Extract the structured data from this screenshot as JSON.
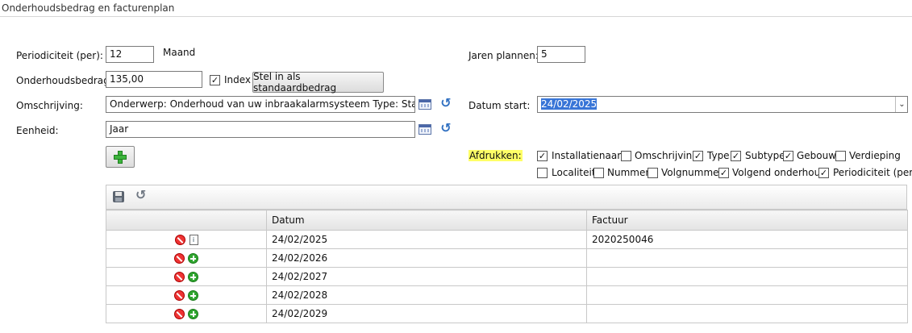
{
  "section": {
    "title": "Onderhoudsbedrag en facturenplan"
  },
  "form": {
    "periodiciteit": {
      "label": "Periodiciteit (per):",
      "value": "12",
      "unit": "Maand"
    },
    "onderhoudsbedrag": {
      "label": "Onderhoudsbedrag:",
      "value": "135,00",
      "index_label": "Index",
      "index_checked": true
    },
    "standaard_button": "Stel in als standaardbedrag",
    "omschrijving": {
      "label": "Omschrijving:",
      "value": "Onderwerp: Onderhoud van uw inbraakalarmsysteem Type: Standaard:"
    },
    "eenheid": {
      "label": "Eenheid:",
      "value": "Jaar"
    },
    "jaren_plannen": {
      "label": "Jaren plannen:",
      "value": "5"
    },
    "datum_start": {
      "label": "Datum start:",
      "value": "24/02/2025"
    }
  },
  "afdrukken": {
    "label": "Afdrukken:",
    "options": [
      {
        "label": "Installatienaam",
        "checked": true
      },
      {
        "label": "Omschrijving",
        "checked": false
      },
      {
        "label": "Type",
        "checked": true
      },
      {
        "label": "Subtype",
        "checked": true
      },
      {
        "label": "Gebouw",
        "checked": true
      },
      {
        "label": "Verdieping",
        "checked": false
      },
      {
        "label": "Localiteit",
        "checked": false
      },
      {
        "label": "Nummer",
        "checked": false
      },
      {
        "label": "Volgnummer",
        "checked": false
      },
      {
        "label": "Volgend onderhoud",
        "checked": true
      },
      {
        "label": "Periodiciteit (per)",
        "checked": true
      }
    ]
  },
  "grid": {
    "columns": [
      "",
      "Datum",
      "Factuur"
    ],
    "rows": [
      {
        "datum": "24/02/2025",
        "factuur": "2020250046",
        "action": "document"
      },
      {
        "datum": "24/02/2026",
        "factuur": "",
        "action": "add"
      },
      {
        "datum": "24/02/2027",
        "factuur": "",
        "action": "add"
      },
      {
        "datum": "24/02/2028",
        "factuur": "",
        "action": "add"
      },
      {
        "datum": "24/02/2029",
        "factuur": "",
        "action": "add"
      }
    ]
  },
  "colors": {
    "highlight": "#ffff66",
    "add_green": "#2fa52f",
    "delete_red": "#e33333",
    "selection_blue": "#3875d7"
  }
}
